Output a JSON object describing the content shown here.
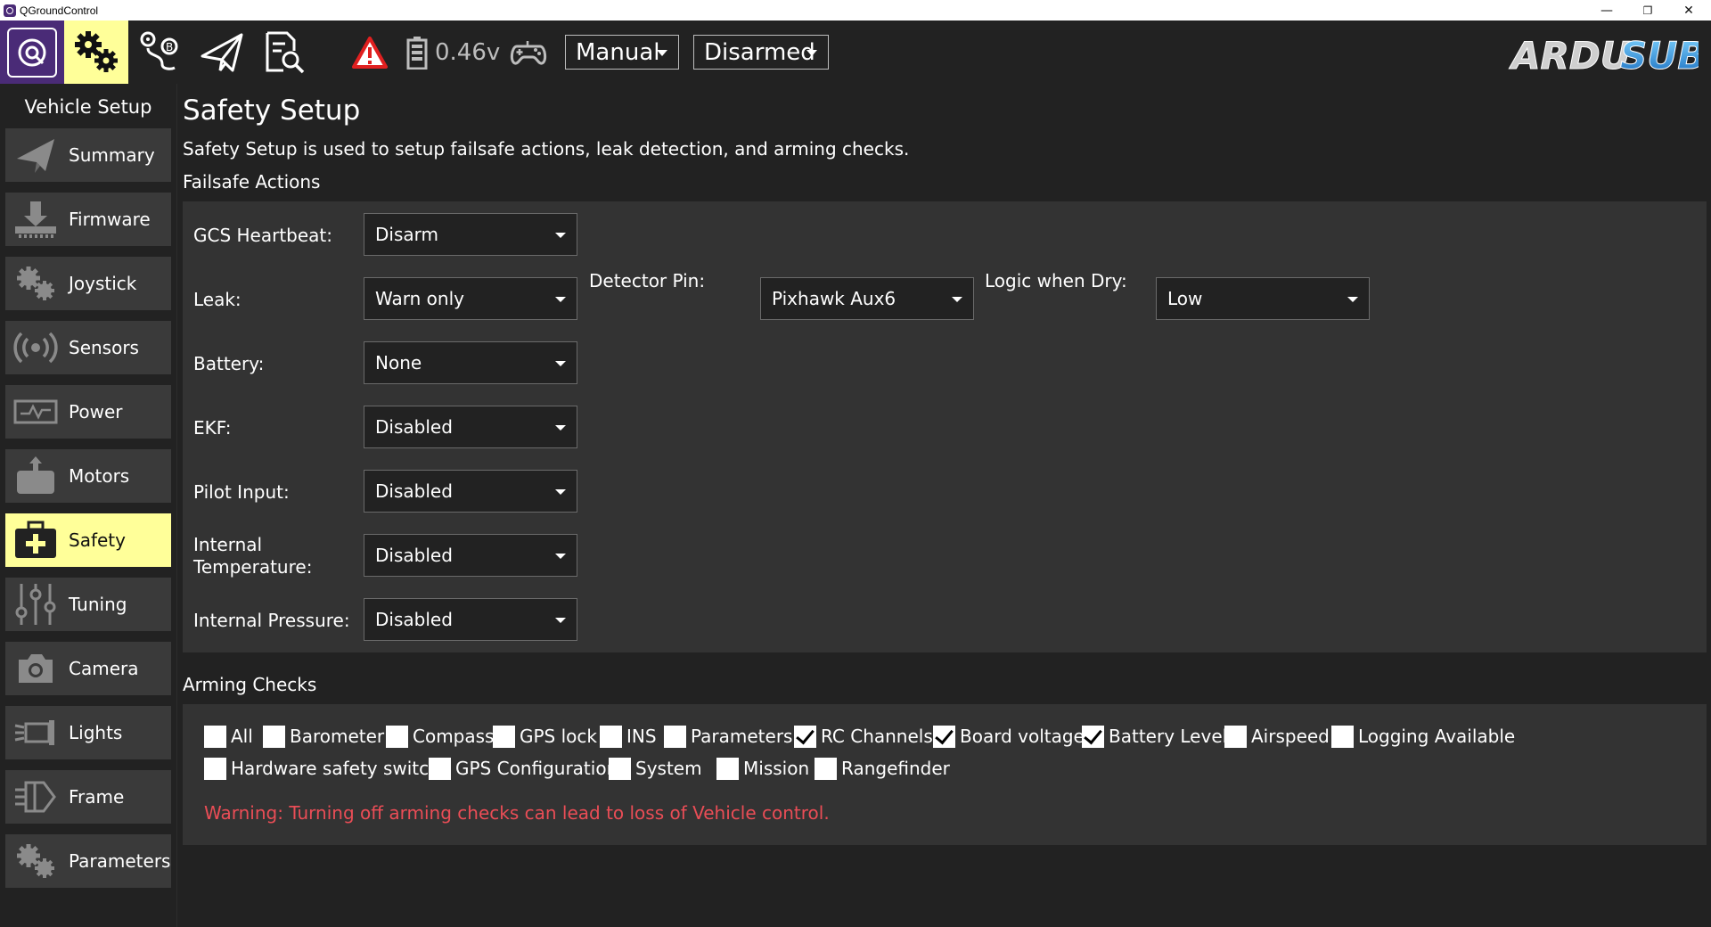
{
  "window": {
    "title": "QGroundControl",
    "controls": {
      "minimize": "—",
      "restore": "❐",
      "close": "✕"
    }
  },
  "toolbar": {
    "battery_voltage": "0.46v",
    "flight_mode": "Manual",
    "arm_state": "Disarmed",
    "warning_color": "#e02020",
    "accent_color": "#ffff99",
    "brand_color": "#4a2b77"
  },
  "sidebar": {
    "title": "Vehicle Setup",
    "items": [
      {
        "label": "Summary",
        "icon": "paper-plane-icon"
      },
      {
        "label": "Firmware",
        "icon": "download-icon"
      },
      {
        "label": "Joystick",
        "icon": "gears-icon"
      },
      {
        "label": "Sensors",
        "icon": "radio-waves-icon"
      },
      {
        "label": "Power",
        "icon": "power-signal-icon"
      },
      {
        "label": "Motors",
        "icon": "motor-icon"
      },
      {
        "label": "Safety",
        "icon": "first-aid-icon"
      },
      {
        "label": "Tuning",
        "icon": "sliders-icon"
      },
      {
        "label": "Camera",
        "icon": "camera-icon"
      },
      {
        "label": "Lights",
        "icon": "light-icon"
      },
      {
        "label": "Frame",
        "icon": "frame-icon"
      },
      {
        "label": "Parameters",
        "icon": "gears-icon"
      }
    ],
    "active": "Safety"
  },
  "page": {
    "title": "Safety Setup",
    "description": "Safety Setup is used to setup failsafe actions, leak detection, and arming checks."
  },
  "failsafe": {
    "section_title": "Failsafe Actions",
    "gcs_heartbeat": {
      "label": "GCS Heartbeat:",
      "value": "Disarm"
    },
    "leak": {
      "label": "Leak:",
      "value": "Warn only"
    },
    "detector_pin": {
      "label": "Detector Pin:",
      "value": "Pixhawk Aux6"
    },
    "logic_when_dry": {
      "label": "Logic when Dry:",
      "value": "Low"
    },
    "battery": {
      "label": "Battery:",
      "value": "None"
    },
    "ekf": {
      "label": "EKF:",
      "value": "Disabled"
    },
    "pilot_input": {
      "label": "Pilot Input:",
      "value": "Disabled"
    },
    "internal_temperature": {
      "label_line1": "Internal",
      "label_line2": "Temperature:",
      "value": "Disabled"
    },
    "internal_pressure": {
      "label": "Internal Pressure:",
      "value": "Disabled"
    }
  },
  "arming": {
    "section_title": "Arming Checks",
    "checks": [
      {
        "label": "All",
        "checked": false
      },
      {
        "label": "Barometer",
        "checked": false
      },
      {
        "label": "Compass",
        "checked": false
      },
      {
        "label": "GPS lock",
        "checked": false
      },
      {
        "label": "INS",
        "checked": false
      },
      {
        "label": "Parameters",
        "checked": false
      },
      {
        "label": "RC Channels",
        "checked": true
      },
      {
        "label": "Board voltage",
        "checked": true
      },
      {
        "label": "Battery Level",
        "checked": true
      },
      {
        "label": "Airspeed",
        "checked": false
      },
      {
        "label": "Logging Available",
        "checked": false
      },
      {
        "label": "Hardware safety switch",
        "checked": false
      },
      {
        "label": "GPS Configuration",
        "checked": false
      },
      {
        "label": "System",
        "checked": false
      },
      {
        "label": "Mission",
        "checked": false
      },
      {
        "label": "Rangefinder",
        "checked": false
      }
    ],
    "warning": "Warning: Turning off arming checks can lead to loss of Vehicle control.",
    "warning_color": "#ea4d56"
  }
}
